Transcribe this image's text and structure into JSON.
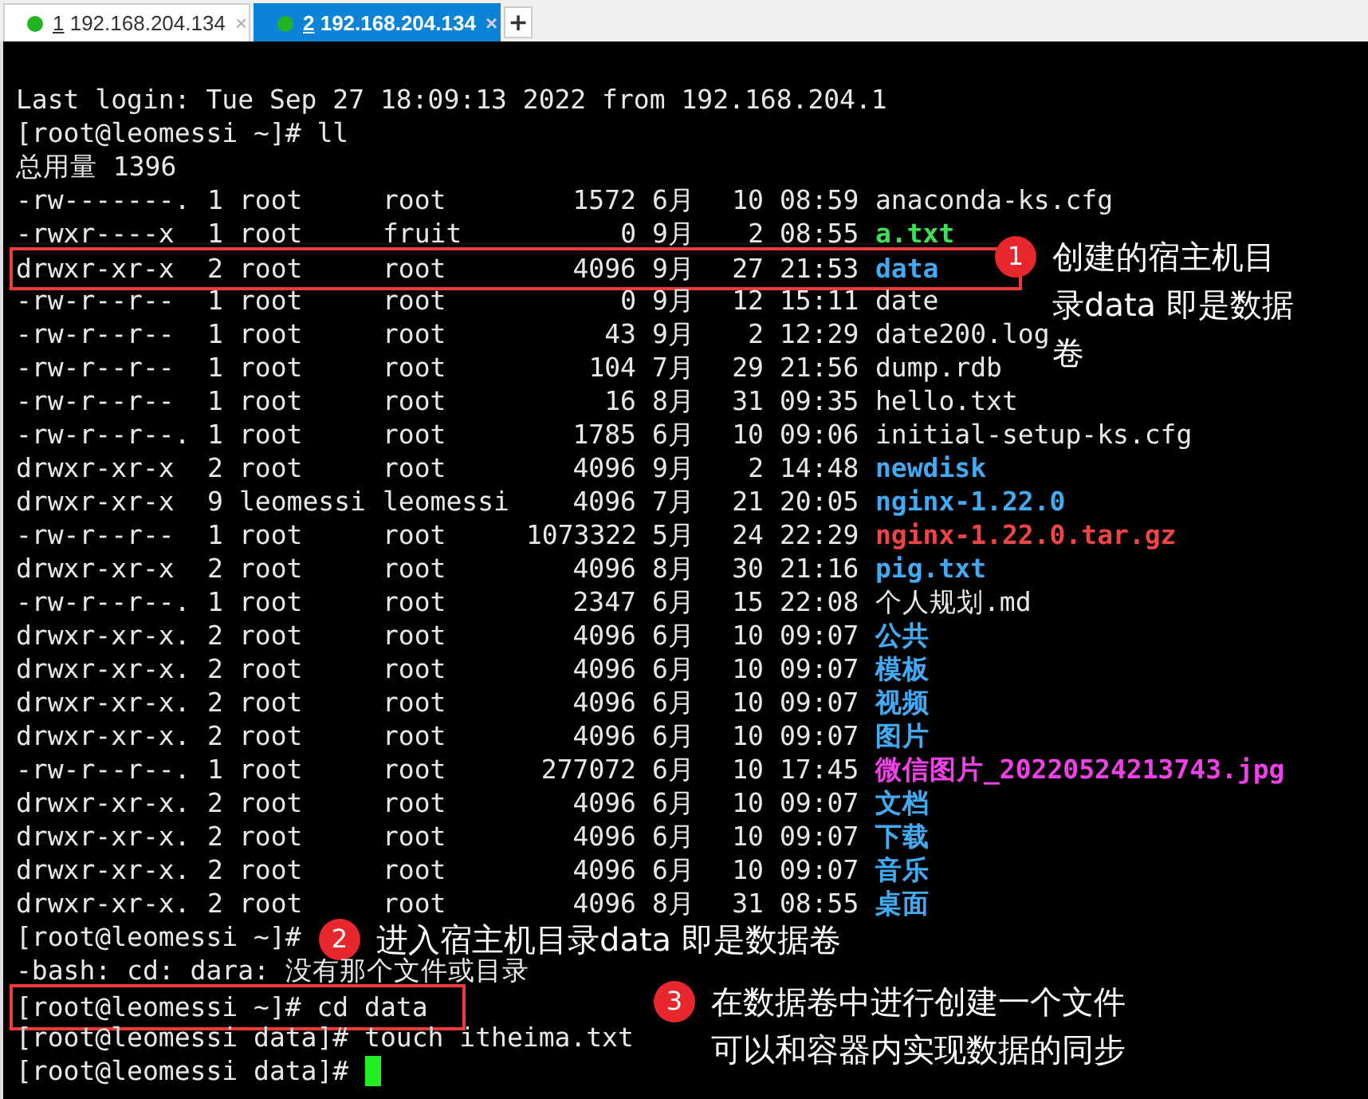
{
  "tabs": [
    {
      "number": "1",
      "host": "192.168.204.134",
      "close": "×",
      "selected": false
    },
    {
      "number": "2",
      "host": "192.168.204.134",
      "close": "×",
      "selected": true
    }
  ],
  "new_tab": "+",
  "terminal": {
    "lines": [
      {
        "kind": "text",
        "text": "Last login: Tue Sep 27 18:09:13 2022 from 192.168.204.1"
      },
      {
        "kind": "text",
        "text": "[root@leomessi ~]# ll"
      },
      {
        "kind": "text",
        "text": "总用量 1396"
      },
      {
        "kind": "file",
        "permissions": "-rw-------.",
        "links": "1",
        "owner": "root",
        "group": "root",
        "size": "1572",
        "month": "6月",
        "day": "10",
        "time": "08:59",
        "name": "anaconda-ks.cfg"
      },
      {
        "kind": "executable",
        "permissions": "-rwxr----x",
        "links": "1",
        "owner": "root",
        "group": "fruit",
        "size": "0",
        "month": "9月",
        "day": "2",
        "time": "08:55",
        "name": "a.txt"
      },
      {
        "kind": "directory",
        "permissions": "drwxr-xr-x",
        "links": "2",
        "owner": "root",
        "group": "root",
        "size": "4096",
        "month": "9月",
        "day": "27",
        "time": "21:53",
        "name": "data",
        "highlighted": true,
        "annotation": {
          "number": "1",
          "lines": [
            "创建的宿主机目",
            "录data 即是数据",
            "卷"
          ]
        }
      },
      {
        "kind": "file",
        "permissions": "-rw-r--r--",
        "links": "1",
        "owner": "root",
        "group": "root",
        "size": "0",
        "month": "9月",
        "day": "12",
        "time": "15:11",
        "name": "date"
      },
      {
        "kind": "file",
        "permissions": "-rw-r--r--",
        "links": "1",
        "owner": "root",
        "group": "root",
        "size": "43",
        "month": "9月",
        "day": "2",
        "time": "12:29",
        "name": "date200.log"
      },
      {
        "kind": "file",
        "permissions": "-rw-r--r--",
        "links": "1",
        "owner": "root",
        "group": "root",
        "size": "104",
        "month": "7月",
        "day": "29",
        "time": "21:56",
        "name": "dump.rdb"
      },
      {
        "kind": "file",
        "permissions": "-rw-r--r--",
        "links": "1",
        "owner": "root",
        "group": "root",
        "size": "16",
        "month": "8月",
        "day": "31",
        "time": "09:35",
        "name": "hello.txt"
      },
      {
        "kind": "file",
        "permissions": "-rw-r--r--.",
        "links": "1",
        "owner": "root",
        "group": "root",
        "size": "1785",
        "month": "6月",
        "day": "10",
        "time": "09:06",
        "name": "initial-setup-ks.cfg"
      },
      {
        "kind": "directory",
        "permissions": "drwxr-xr-x",
        "links": "2",
        "owner": "root",
        "group": "root",
        "size": "4096",
        "month": "9月",
        "day": "2",
        "time": "14:48",
        "name": "newdisk"
      },
      {
        "kind": "directory",
        "permissions": "drwxr-xr-x",
        "links": "9",
        "owner": "leomessi",
        "group": "leomessi",
        "size": "4096",
        "month": "7月",
        "day": "21",
        "time": "20:05",
        "name": "nginx-1.22.0"
      },
      {
        "kind": "archive",
        "permissions": "-rw-r--r--",
        "links": "1",
        "owner": "root",
        "group": "root",
        "size": "1073322",
        "month": "5月",
        "day": "24",
        "time": "22:29",
        "name": "nginx-1.22.0.tar.gz"
      },
      {
        "kind": "directory",
        "permissions": "drwxr-xr-x",
        "links": "2",
        "owner": "root",
        "group": "root",
        "size": "4096",
        "month": "8月",
        "day": "30",
        "time": "21:16",
        "name": "pig.txt"
      },
      {
        "kind": "file",
        "permissions": "-rw-r--r--.",
        "links": "1",
        "owner": "root",
        "group": "root",
        "size": "2347",
        "month": "6月",
        "day": "15",
        "time": "22:08",
        "name": "个人规划.md"
      },
      {
        "kind": "directory",
        "permissions": "drwxr-xr-x.",
        "links": "2",
        "owner": "root",
        "group": "root",
        "size": "4096",
        "month": "6月",
        "day": "10",
        "time": "09:07",
        "name": "公共"
      },
      {
        "kind": "directory",
        "permissions": "drwxr-xr-x.",
        "links": "2",
        "owner": "root",
        "group": "root",
        "size": "4096",
        "month": "6月",
        "day": "10",
        "time": "09:07",
        "name": "模板"
      },
      {
        "kind": "directory",
        "permissions": "drwxr-xr-x.",
        "links": "2",
        "owner": "root",
        "group": "root",
        "size": "4096",
        "month": "6月",
        "day": "10",
        "time": "09:07",
        "name": "视频"
      },
      {
        "kind": "directory",
        "permissions": "drwxr-xr-x.",
        "links": "2",
        "owner": "root",
        "group": "root",
        "size": "4096",
        "month": "6月",
        "day": "10",
        "time": "09:07",
        "name": "图片"
      },
      {
        "kind": "image",
        "permissions": "-rw-r--r--.",
        "links": "1",
        "owner": "root",
        "group": "root",
        "size": "277072",
        "month": "6月",
        "day": "10",
        "time": "17:45",
        "name": "微信图片_20220524213743.jpg"
      },
      {
        "kind": "directory",
        "permissions": "drwxr-xr-x.",
        "links": "2",
        "owner": "root",
        "group": "root",
        "size": "4096",
        "month": "6月",
        "day": "10",
        "time": "09:07",
        "name": "文档"
      },
      {
        "kind": "directory",
        "permissions": "drwxr-xr-x.",
        "links": "2",
        "owner": "root",
        "group": "root",
        "size": "4096",
        "month": "6月",
        "day": "10",
        "time": "09:07",
        "name": "下载"
      },
      {
        "kind": "directory",
        "permissions": "drwxr-xr-x.",
        "links": "2",
        "owner": "root",
        "group": "root",
        "size": "4096",
        "month": "6月",
        "day": "10",
        "time": "09:07",
        "name": "音乐"
      },
      {
        "kind": "directory",
        "permissions": "drwxr-xr-x.",
        "links": "2",
        "owner": "root",
        "group": "root",
        "size": "4096",
        "month": "8月",
        "day": "31",
        "time": "08:55",
        "name": "桌面"
      },
      {
        "kind": "text",
        "text": "[root@leomessi ~]#",
        "annotation": {
          "number": "2",
          "lines": [
            "进入宿主机目录data 即是数据卷"
          ]
        }
      },
      {
        "kind": "text",
        "text": "-bash: cd: dara: 没有那个文件或目录"
      },
      {
        "kind": "text",
        "text": "[root@leomessi ~]# cd data",
        "highlighted": true,
        "annotation": {
          "number": "3",
          "lines": [
            "在数据卷中进行创建一个文件",
            "可以和容器内实现数据的同步"
          ]
        }
      },
      {
        "kind": "text",
        "text": "[root@leomessi data]# touch itheima.txt"
      },
      {
        "kind": "text",
        "text": "[root@leomessi data]#",
        "cursor": true
      }
    ]
  }
}
